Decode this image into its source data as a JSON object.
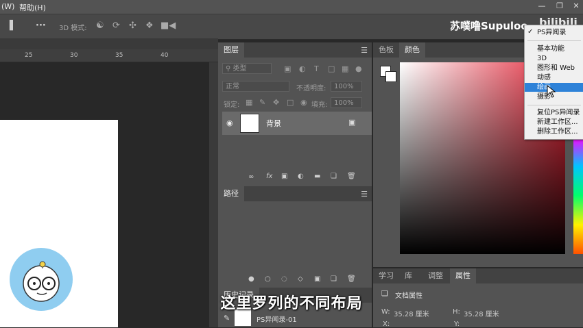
{
  "menubar": {
    "item_w": "(W)",
    "item_help": "帮助(H)"
  },
  "options": {
    "mode_label": "3D 模式:"
  },
  "ruler": {
    "ticks": [
      "25",
      "30",
      "35",
      "40"
    ]
  },
  "watermark": {
    "text": "苏噗噜Supuloo",
    "logo": "bilibili"
  },
  "layers_panel": {
    "tab": "图层",
    "filter_placeholder": "类型",
    "blend_mode": "正常",
    "opacity_label": "不透明度:",
    "opacity_value": "100%",
    "lock_label": "锁定:",
    "fill_label": "填充:",
    "fill_value": "100%",
    "layer_name": "背景",
    "fx_label": "fx"
  },
  "paths_panel": {
    "tab": "路径"
  },
  "history_panel": {
    "tab": "历史记录",
    "item": "PS异闻录-01"
  },
  "color_panel": {
    "tab_swatches": "色板",
    "tab_color": "颜色"
  },
  "bottom_panel": {
    "tabs": [
      "学习",
      "库",
      "调整",
      "属性"
    ],
    "doc_label": "文档属性",
    "w_label": "W:",
    "w_value": "35.28 厘米",
    "h_label": "H:",
    "h_value": "35.28 厘米",
    "x_label": "X:",
    "y_label": "Y:"
  },
  "workspace_menu": {
    "checked": "PS异闻录",
    "items": [
      "基本功能",
      "3D",
      "图形和 Web",
      "动感",
      "绘画",
      "摄影"
    ],
    "actions": [
      "复位PS异闻录",
      "新建工作区...",
      "删除工作区..."
    ],
    "highlight_index": 4
  },
  "subtitle": "这里罗列的不同布局",
  "colors": {
    "accent": "#2e82d8",
    "panel": "#535353",
    "canvas": "#282828"
  }
}
